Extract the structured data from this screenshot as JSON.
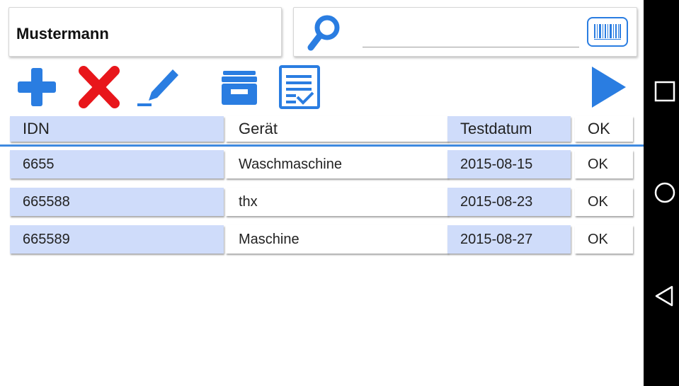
{
  "customer": {
    "name": "Mustermann"
  },
  "search": {
    "value": "",
    "placeholder": ""
  },
  "icons": {
    "search": "search-icon",
    "barcode": "barcode-icon",
    "add": "plus-icon",
    "delete": "x-icon",
    "edit": "pencil-icon",
    "archive": "archive-box-icon",
    "report": "checklist-icon",
    "next": "play-arrow-icon"
  },
  "colors": {
    "accent": "#2a7de1",
    "delete": "#e8161b",
    "cell_highlight": "#cfdcfa",
    "divider": "#3f8ae0"
  },
  "table": {
    "headers": [
      "IDN",
      "Gerät",
      "Testdatum",
      "OK"
    ],
    "rows": [
      [
        "6655",
        "Waschmaschine",
        "2015-08-15",
        "OK"
      ],
      [
        "665588",
        "thx",
        "2015-08-23",
        "OK"
      ],
      [
        "665589",
        "Maschine",
        "2015-08-27",
        "OK"
      ]
    ]
  }
}
